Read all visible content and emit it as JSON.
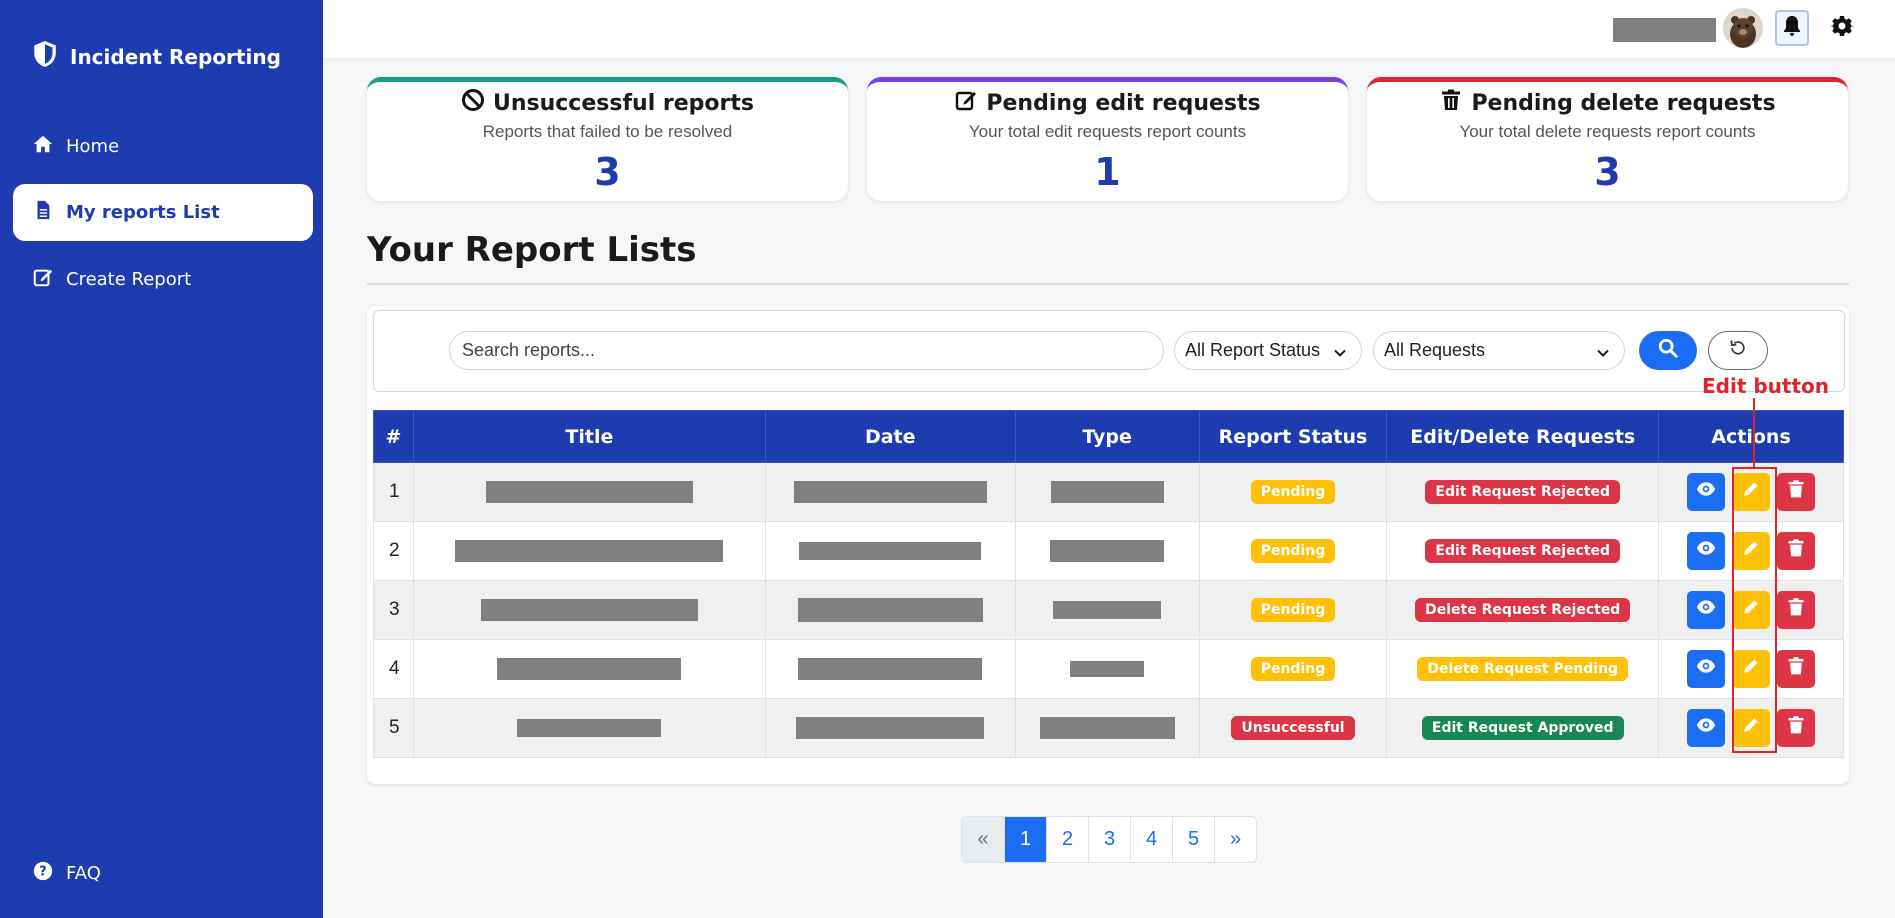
{
  "sidebar": {
    "brand": "Incident Reporting",
    "items": [
      {
        "label": "Home"
      },
      {
        "label": "My reports List"
      },
      {
        "label": "Create Report"
      }
    ],
    "faq": "FAQ"
  },
  "stats": [
    {
      "title": "Unsuccessful reports",
      "subtitle": "Reports that failed to be resolved",
      "count": "3"
    },
    {
      "title": "Pending edit requests",
      "subtitle": "Your total edit requests report counts",
      "count": "1"
    },
    {
      "title": "Pending delete requests",
      "subtitle": "Your total delete requests report counts",
      "count": "3"
    }
  ],
  "page_title": "Your Report Lists",
  "filters": {
    "search_placeholder": "Search reports...",
    "status_select": "All Report Status",
    "request_select": "All Requests"
  },
  "table": {
    "headers": [
      "#",
      "Title",
      "Date",
      "Type",
      "Report Status",
      "Edit/Delete Requests",
      "Actions"
    ],
    "rows": [
      {
        "num": "1",
        "status": "Pending",
        "request": "Edit Request Rejected"
      },
      {
        "num": "2",
        "status": "Pending",
        "request": "Edit Request Rejected"
      },
      {
        "num": "3",
        "status": "Pending",
        "request": "Delete Request Rejected"
      },
      {
        "num": "4",
        "status": "Pending",
        "request": "Delete Request Pending"
      },
      {
        "num": "5",
        "status": "Unsuccessful",
        "request": "Edit Request Approved"
      }
    ]
  },
  "annotation": {
    "label": "Edit button"
  },
  "pagination": {
    "prev": "«",
    "pages": [
      "1",
      "2",
      "3",
      "4",
      "5"
    ],
    "next": "»",
    "current": "1"
  },
  "colors": {
    "sidebar": "#1f3bb0",
    "primary": "#1b6ef3",
    "warning": "#ffc107",
    "danger": "#dc3545",
    "success": "#198754",
    "annotation": "#e0242c"
  }
}
